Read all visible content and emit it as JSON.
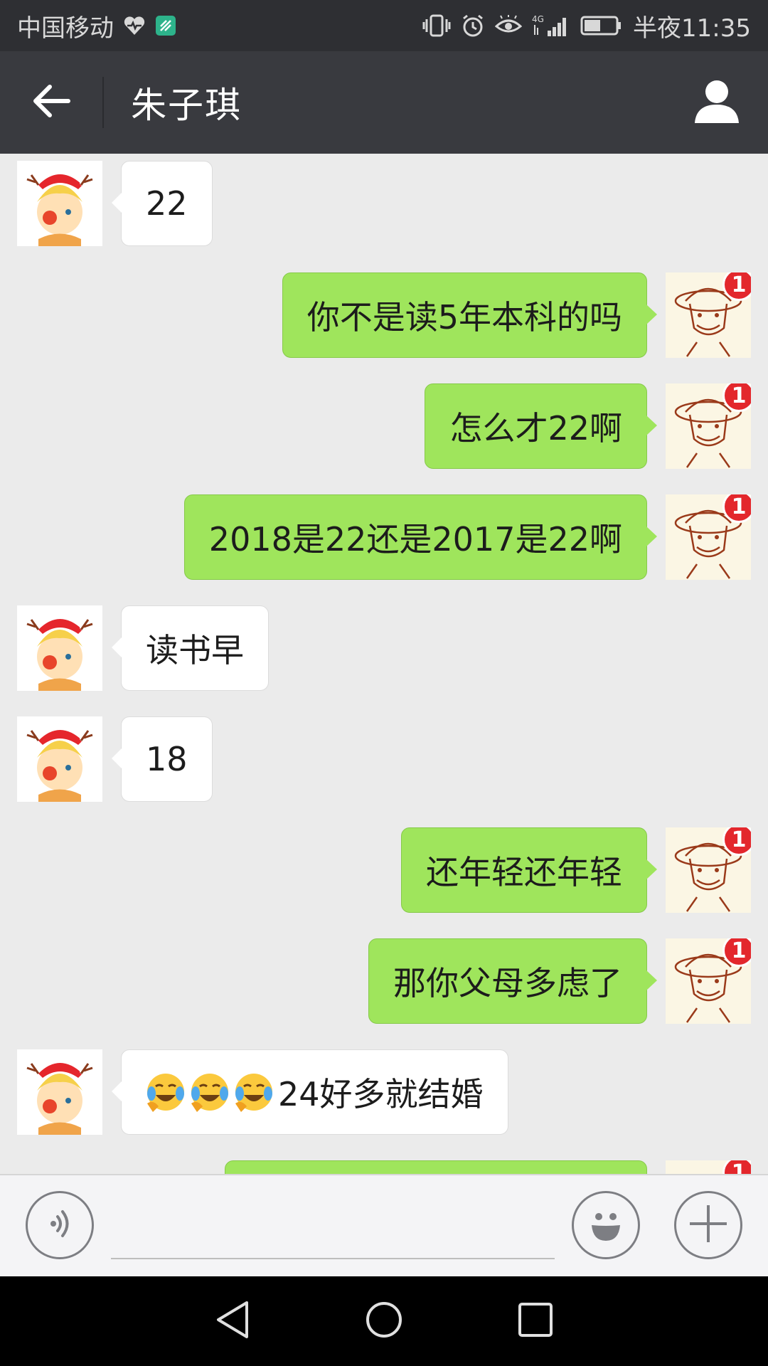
{
  "status_bar": {
    "carrier": "中国移动",
    "network": "4G",
    "time": "半夜11:35"
  },
  "header": {
    "title": "朱子琪",
    "back_icon": "back-arrow-icon",
    "profile_icon": "person-icon"
  },
  "messages": [
    {
      "from": "contact",
      "text": "22"
    },
    {
      "from": "me",
      "text": "你不是读5年本科的吗",
      "badge": "1"
    },
    {
      "from": "me",
      "text": "怎么才22啊",
      "badge": "1"
    },
    {
      "from": "me",
      "text": "2018是22还是2017是22啊",
      "badge": "1"
    },
    {
      "from": "contact",
      "text": "读书早"
    },
    {
      "from": "contact",
      "text": "18"
    },
    {
      "from": "me",
      "text": "还年轻还年轻",
      "badge": "1"
    },
    {
      "from": "me",
      "text": "那你父母多虑了",
      "badge": "1"
    },
    {
      "from": "contact",
      "text": "24好多就结婚",
      "emojis": [
        "crying-laughing-emoji",
        "crying-laughing-emoji",
        "crying-laughing-emoji"
      ]
    },
    {
      "from": "me",
      "text": "",
      "badge": "1"
    }
  ],
  "input_bar": {
    "value": "",
    "voice_icon": "voice-icon",
    "emoji_icon": "smiley-icon",
    "more_icon": "plus-icon"
  },
  "nav_bar": {
    "back_icon": "nav-back-icon",
    "home_icon": "nav-home-icon",
    "recent_icon": "nav-recent-icon"
  },
  "colors": {
    "header": "#393a3f",
    "status_bar": "#2e2f33",
    "chat_background": "#ebebeb",
    "outgoing_bubble": "#9fe55c",
    "incoming_bubble": "#ffffff",
    "badge": "#e3272c"
  }
}
